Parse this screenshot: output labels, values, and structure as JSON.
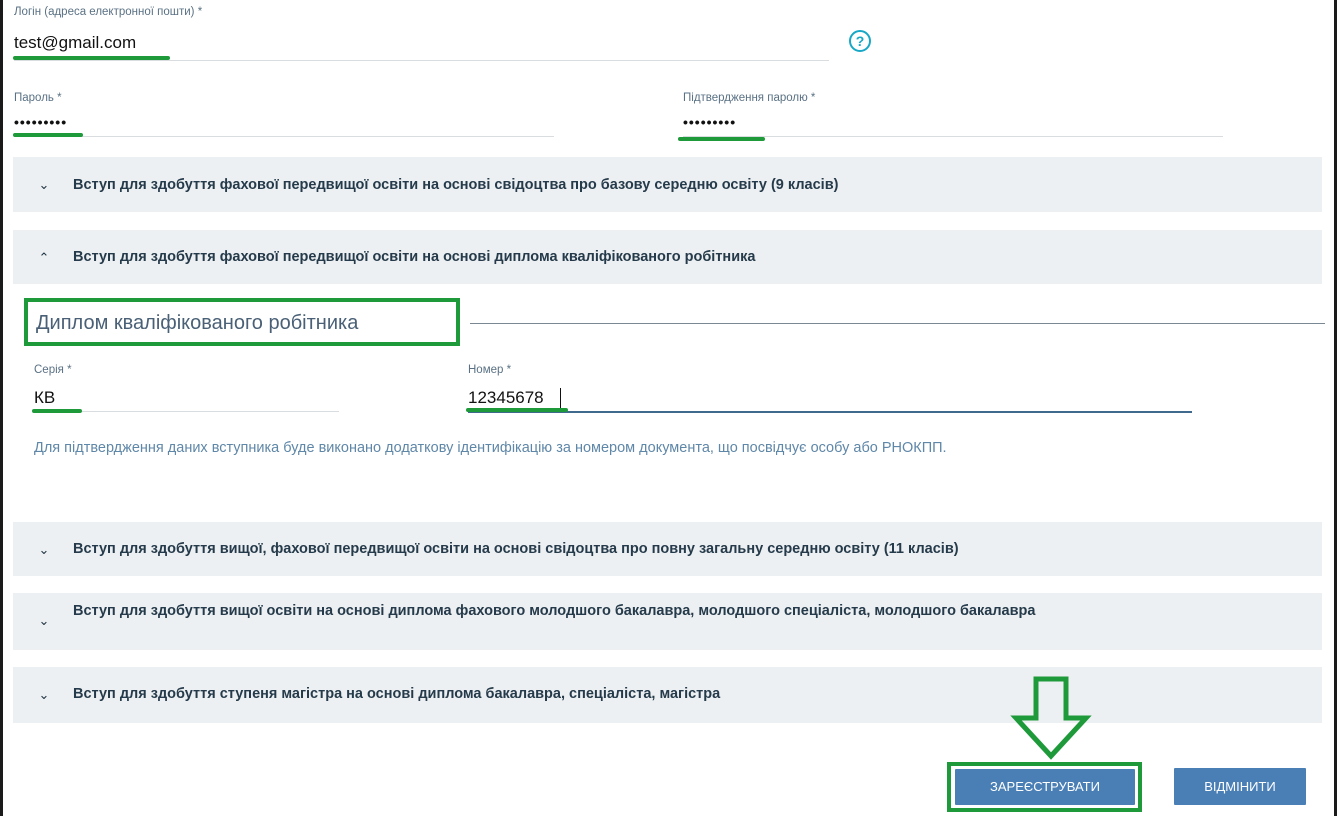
{
  "login": {
    "label": "Логін (адреса електронної пошти) *",
    "value": "test@gmail.com",
    "help_icon": "?"
  },
  "password": {
    "label": "Пароль *",
    "value": "•••••••••"
  },
  "password_confirm": {
    "label": "Підтвердження паролю *",
    "value": "•••••••••"
  },
  "sections": [
    {
      "title": "Вступ для здобуття фахової передвищої освіти на основі свідоцтва про базову середню освіту (9 класів)",
      "chevron": "⌄",
      "expanded": false
    },
    {
      "title": "Вступ для здобуття фахової передвищої освіти на основі диплома кваліфікованого робітника",
      "chevron": "⌃",
      "expanded": true
    },
    {
      "title": "Вступ для здобуття вищої, фахової передвищої освіти на основі свідоцтва про повну загальну середню освіту (11 класів)",
      "chevron": "⌄",
      "expanded": false
    },
    {
      "title": "Вступ для здобуття вищої освіти на основі диплома фахового молодшого бакалавра, молодшого спеціаліста, молодшого бакалавра",
      "chevron": "⌄",
      "expanded": false
    },
    {
      "title": "Вступ для здобуття ступеня магістра на основі диплома бакалавра, спеціаліста, магістра",
      "chevron": "⌄",
      "expanded": false
    }
  ],
  "diploma": {
    "legend": "Диплом кваліфікованого робітника",
    "series_label": "Серія *",
    "series_value": "КВ",
    "number_label": "Номер *",
    "number_value": "12345678",
    "info": "Для підтвердження даних вступника буде виконано додаткову ідентифікацію за номером документа, що посвідчує особу або РНОКПП."
  },
  "buttons": {
    "register": "ЗАРЕЄСТРУВАТИ",
    "cancel": "ВІДМІНИТИ"
  },
  "colors": {
    "highlight": "#1e9a3a",
    "button": "#4a7fb6",
    "accordion_bg": "#edf0f2"
  }
}
